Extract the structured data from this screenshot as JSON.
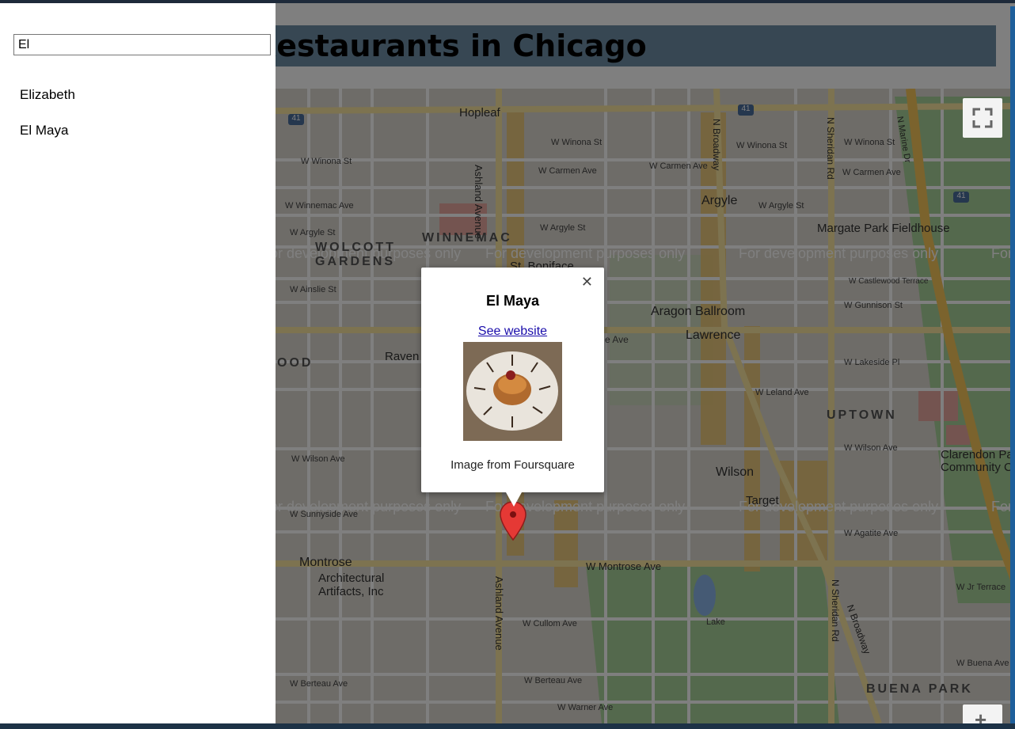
{
  "header": {
    "title": "Near Me Restaurants in Chicago"
  },
  "sidebar": {
    "search": {
      "value": "El"
    },
    "results": [
      {
        "label": "Elizabeth"
      },
      {
        "label": "El Maya"
      }
    ]
  },
  "map": {
    "watermark": "For development purposes only",
    "labels": {
      "hopleaf": "Hopleaf",
      "argyle": "Argyle",
      "argyle_st": "W Argyle St",
      "winona": "W Winona St",
      "carmen": "W Carmen Ave",
      "winnemac": "W Winnemac Ave",
      "winnemac_n": "WINNEMAC",
      "wolcott": "WOLCOTT",
      "gardens": "GARDENS",
      "boniface": "St. Boniface",
      "margate": "Margate Park Fieldhouse",
      "aragon": "Aragon Ballroom",
      "lawrence": "Lawrence",
      "lawrence_ave": "e Ave",
      "ainslie": "W Ainslie St",
      "castlewood": "W Castlewood Terrace",
      "gunnison": "W Gunnison St",
      "lakeside": "W Lakeside Pl",
      "leland": "W Leland Ave",
      "uptown": "UPTOWN",
      "wilson_ave": "W Wilson Ave",
      "wilson": "Wilson",
      "clarendon": "Clarendon Pa",
      "community": "Community C",
      "target": "Target",
      "montrose": "Montrose",
      "montrose_ave": "W Montrose Ave",
      "artifacts1": "Architectural",
      "artifacts2": "Artifacts, Inc",
      "agatite": "W Agatite Ave",
      "cullom": "W Cullom Ave",
      "berteau": "W Berteau Ave",
      "berteau2": "W Berteau Ave",
      "warner": "W Warner Ave",
      "buena_park": "BUENA PARK",
      "buena_ave": "W Buena Ave",
      "jr_terrace": "W Jr Terrace",
      "ravens": "Raven",
      "ood": "OOD",
      "sunnyside": "W Sunnyside Ave",
      "lake": "Lake",
      "ashland": "Ashland Avenue",
      "broadway": "N Broadway",
      "sheridan": "N Sheridan Rd",
      "marine": "N Marine Dr",
      "route": "41"
    }
  },
  "infowindow": {
    "title": "El Maya",
    "link": "See website",
    "caption": "Image from Foursquare"
  },
  "controls": {
    "zoom_in": "+"
  }
}
